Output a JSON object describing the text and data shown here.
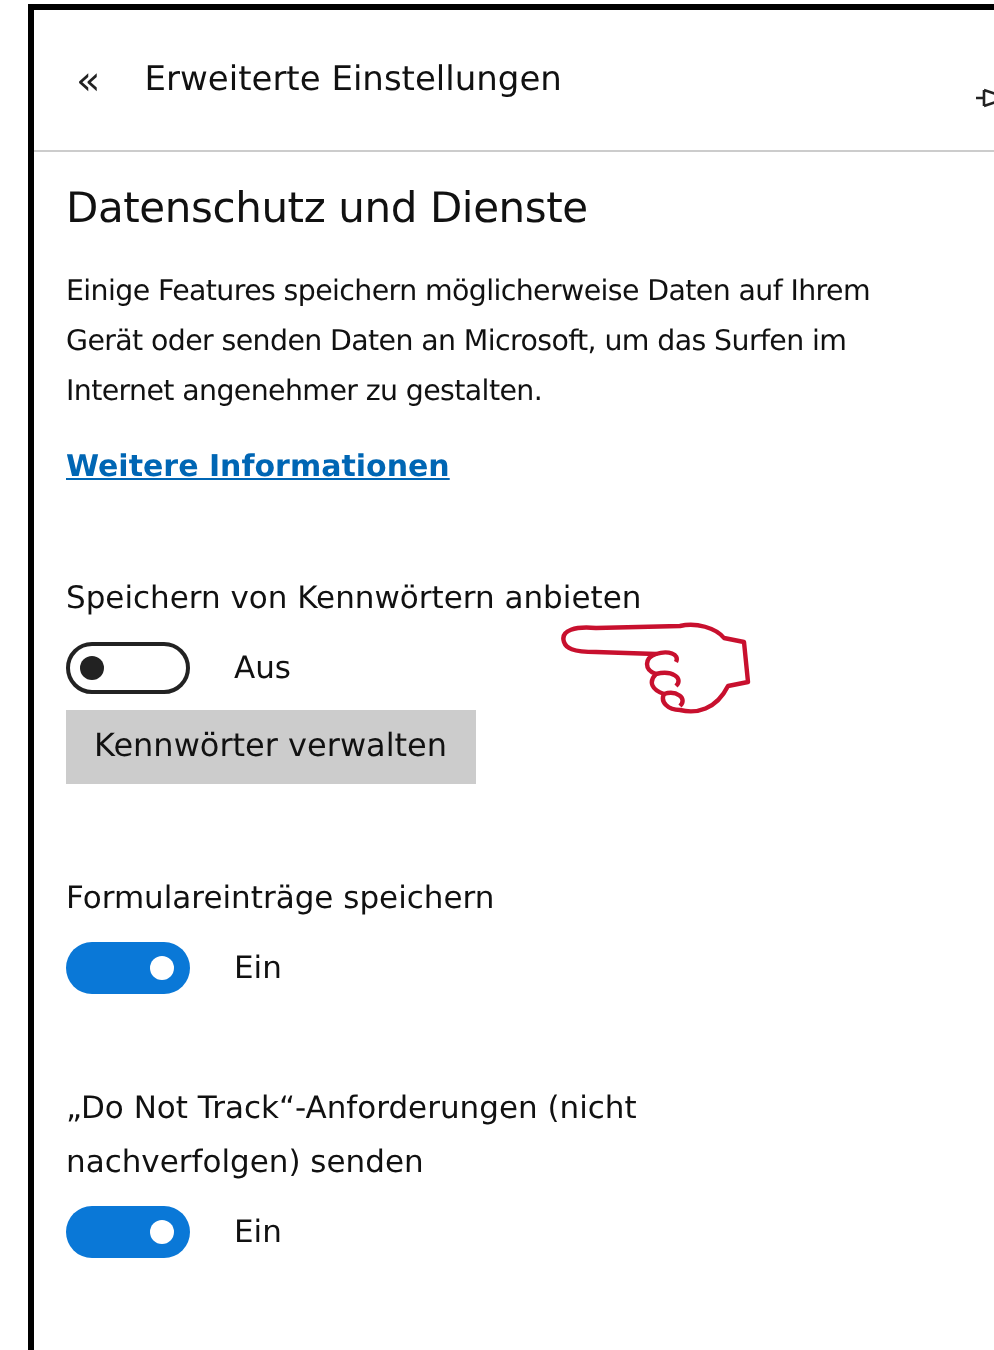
{
  "header": {
    "back_glyph": "«",
    "title": "Erweiterte Einstellungen"
  },
  "page": {
    "title": "Datenschutz und Dienste",
    "description": "Einige Features speichern möglicherweise Daten auf Ihrem Gerät oder senden Daten an Microsoft, um das Surfen im Internet angenehmer zu gestalten.",
    "link": "Weitere Informationen"
  },
  "settings": [
    {
      "kind": "toggle",
      "label": "Speichern von Kennwörtern anbieten",
      "on": false,
      "state_text": "Aus",
      "pointer": true
    },
    {
      "kind": "button",
      "label": "Kennwörter verwalten"
    },
    {
      "kind": "toggle",
      "label": "Formulareinträge speichern",
      "on": true,
      "state_text": "Ein",
      "pointer": false
    },
    {
      "kind": "toggle",
      "label": "„Do Not Track“-Anforderungen (nicht nachverfolgen) senden",
      "on": true,
      "state_text": "Ein",
      "pointer": false
    }
  ]
}
